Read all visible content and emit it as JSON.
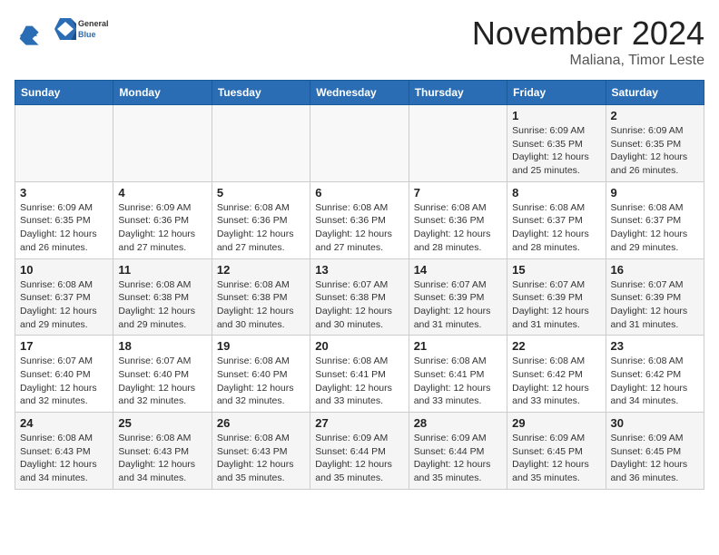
{
  "logo": {
    "general": "General",
    "blue": "Blue"
  },
  "header": {
    "month": "November 2024",
    "location": "Maliana, Timor Leste"
  },
  "weekdays": [
    "Sunday",
    "Monday",
    "Tuesday",
    "Wednesday",
    "Thursday",
    "Friday",
    "Saturday"
  ],
  "weeks": [
    [
      {
        "day": "",
        "info": ""
      },
      {
        "day": "",
        "info": ""
      },
      {
        "day": "",
        "info": ""
      },
      {
        "day": "",
        "info": ""
      },
      {
        "day": "",
        "info": ""
      },
      {
        "day": "1",
        "info": "Sunrise: 6:09 AM\nSunset: 6:35 PM\nDaylight: 12 hours and 25 minutes."
      },
      {
        "day": "2",
        "info": "Sunrise: 6:09 AM\nSunset: 6:35 PM\nDaylight: 12 hours and 26 minutes."
      }
    ],
    [
      {
        "day": "3",
        "info": "Sunrise: 6:09 AM\nSunset: 6:35 PM\nDaylight: 12 hours and 26 minutes."
      },
      {
        "day": "4",
        "info": "Sunrise: 6:09 AM\nSunset: 6:36 PM\nDaylight: 12 hours and 27 minutes."
      },
      {
        "day": "5",
        "info": "Sunrise: 6:08 AM\nSunset: 6:36 PM\nDaylight: 12 hours and 27 minutes."
      },
      {
        "day": "6",
        "info": "Sunrise: 6:08 AM\nSunset: 6:36 PM\nDaylight: 12 hours and 27 minutes."
      },
      {
        "day": "7",
        "info": "Sunrise: 6:08 AM\nSunset: 6:36 PM\nDaylight: 12 hours and 28 minutes."
      },
      {
        "day": "8",
        "info": "Sunrise: 6:08 AM\nSunset: 6:37 PM\nDaylight: 12 hours and 28 minutes."
      },
      {
        "day": "9",
        "info": "Sunrise: 6:08 AM\nSunset: 6:37 PM\nDaylight: 12 hours and 29 minutes."
      }
    ],
    [
      {
        "day": "10",
        "info": "Sunrise: 6:08 AM\nSunset: 6:37 PM\nDaylight: 12 hours and 29 minutes."
      },
      {
        "day": "11",
        "info": "Sunrise: 6:08 AM\nSunset: 6:38 PM\nDaylight: 12 hours and 29 minutes."
      },
      {
        "day": "12",
        "info": "Sunrise: 6:08 AM\nSunset: 6:38 PM\nDaylight: 12 hours and 30 minutes."
      },
      {
        "day": "13",
        "info": "Sunrise: 6:07 AM\nSunset: 6:38 PM\nDaylight: 12 hours and 30 minutes."
      },
      {
        "day": "14",
        "info": "Sunrise: 6:07 AM\nSunset: 6:39 PM\nDaylight: 12 hours and 31 minutes."
      },
      {
        "day": "15",
        "info": "Sunrise: 6:07 AM\nSunset: 6:39 PM\nDaylight: 12 hours and 31 minutes."
      },
      {
        "day": "16",
        "info": "Sunrise: 6:07 AM\nSunset: 6:39 PM\nDaylight: 12 hours and 31 minutes."
      }
    ],
    [
      {
        "day": "17",
        "info": "Sunrise: 6:07 AM\nSunset: 6:40 PM\nDaylight: 12 hours and 32 minutes."
      },
      {
        "day": "18",
        "info": "Sunrise: 6:07 AM\nSunset: 6:40 PM\nDaylight: 12 hours and 32 minutes."
      },
      {
        "day": "19",
        "info": "Sunrise: 6:08 AM\nSunset: 6:40 PM\nDaylight: 12 hours and 32 minutes."
      },
      {
        "day": "20",
        "info": "Sunrise: 6:08 AM\nSunset: 6:41 PM\nDaylight: 12 hours and 33 minutes."
      },
      {
        "day": "21",
        "info": "Sunrise: 6:08 AM\nSunset: 6:41 PM\nDaylight: 12 hours and 33 minutes."
      },
      {
        "day": "22",
        "info": "Sunrise: 6:08 AM\nSunset: 6:42 PM\nDaylight: 12 hours and 33 minutes."
      },
      {
        "day": "23",
        "info": "Sunrise: 6:08 AM\nSunset: 6:42 PM\nDaylight: 12 hours and 34 minutes."
      }
    ],
    [
      {
        "day": "24",
        "info": "Sunrise: 6:08 AM\nSunset: 6:43 PM\nDaylight: 12 hours and 34 minutes."
      },
      {
        "day": "25",
        "info": "Sunrise: 6:08 AM\nSunset: 6:43 PM\nDaylight: 12 hours and 34 minutes."
      },
      {
        "day": "26",
        "info": "Sunrise: 6:08 AM\nSunset: 6:43 PM\nDaylight: 12 hours and 35 minutes."
      },
      {
        "day": "27",
        "info": "Sunrise: 6:09 AM\nSunset: 6:44 PM\nDaylight: 12 hours and 35 minutes."
      },
      {
        "day": "28",
        "info": "Sunrise: 6:09 AM\nSunset: 6:44 PM\nDaylight: 12 hours and 35 minutes."
      },
      {
        "day": "29",
        "info": "Sunrise: 6:09 AM\nSunset: 6:45 PM\nDaylight: 12 hours and 35 minutes."
      },
      {
        "day": "30",
        "info": "Sunrise: 6:09 AM\nSunset: 6:45 PM\nDaylight: 12 hours and 36 minutes."
      }
    ]
  ]
}
